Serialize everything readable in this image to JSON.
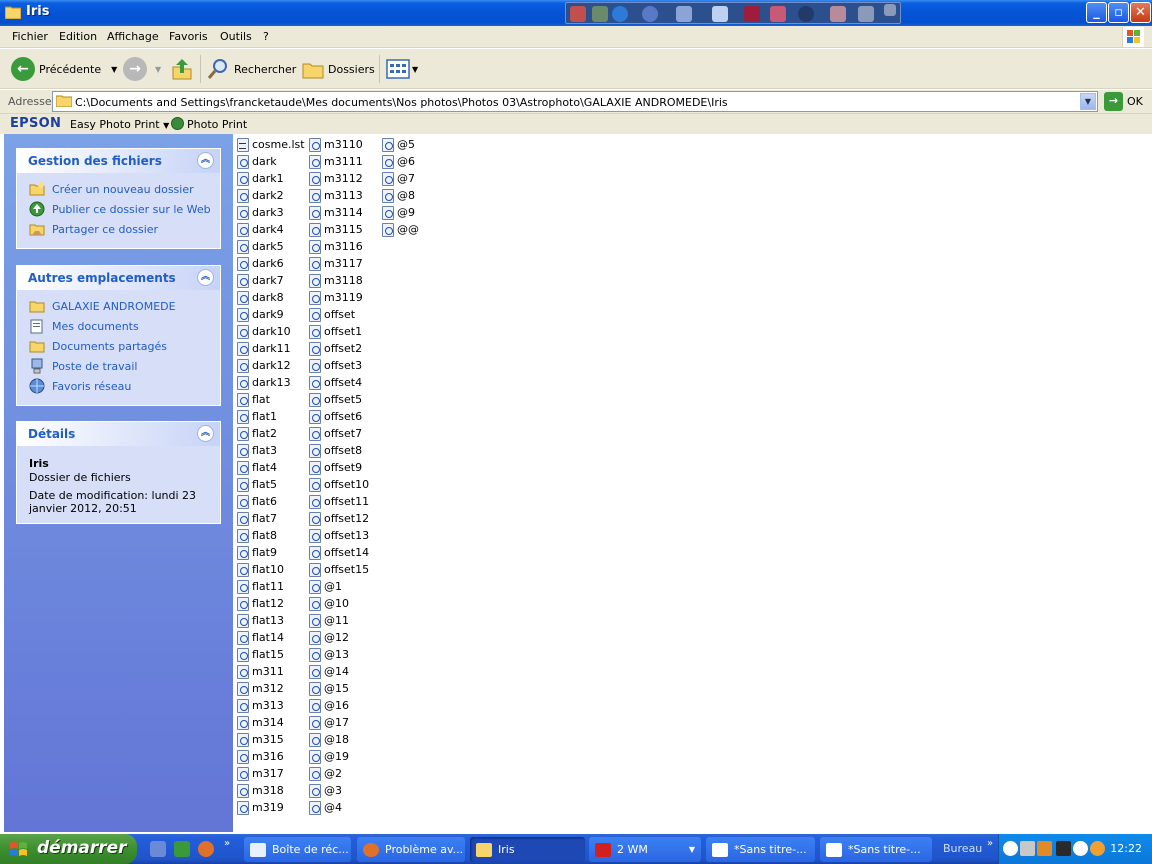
{
  "window": {
    "title": "Iris"
  },
  "menu": [
    "Fichier",
    "Edition",
    "Affichage",
    "Favoris",
    "Outils",
    "?"
  ],
  "toolbar": {
    "back_label": "Précédente",
    "search_label": "Rechercher",
    "folders_label": "Dossiers"
  },
  "address": {
    "label": "Adresse",
    "path": "C:\\Documents and Settings\\francketaude\\Mes documents\\Nos photos\\Photos 03\\Astrophoto\\GALAXIE ANDROMEDE\\Iris",
    "go_label": "OK"
  },
  "epson": {
    "brand": "EPSON",
    "easy_photo_print": "Easy Photo Print",
    "photo_print": "Photo Print"
  },
  "sidebar": {
    "file_tasks": {
      "title": "Gestion des fichiers",
      "items": [
        {
          "label": "Créer un nouveau dossier",
          "icon": "new-folder-icon"
        },
        {
          "label": "Publier ce dossier sur le Web",
          "icon": "web-publish-icon"
        },
        {
          "label": "Partager ce dossier",
          "icon": "share-folder-icon"
        }
      ]
    },
    "other_places": {
      "title": "Autres emplacements",
      "items": [
        {
          "label": "GALAXIE ANDROMEDE",
          "icon": "folder-icon"
        },
        {
          "label": "Mes documents",
          "icon": "my-documents-icon"
        },
        {
          "label": "Documents partagés",
          "icon": "shared-folder-icon"
        },
        {
          "label": "Poste de travail",
          "icon": "my-computer-icon"
        },
        {
          "label": "Favoris réseau",
          "icon": "network-icon"
        }
      ]
    },
    "details": {
      "title": "Détails",
      "name": "Iris",
      "type": "Dossier de fichiers",
      "modified_line1": "Date de modification: lundi 23",
      "modified_line2": "janvier 2012, 20:51"
    }
  },
  "files": {
    "column1": [
      "cosme.lst",
      "dark",
      "dark1",
      "dark2",
      "dark3",
      "dark4",
      "dark5",
      "dark6",
      "dark7",
      "dark8",
      "dark9",
      "dark10",
      "dark11",
      "dark12",
      "dark13",
      "flat",
      "flat1",
      "flat2",
      "flat3",
      "flat4",
      "flat5",
      "flat6",
      "flat7",
      "flat8",
      "flat9",
      "flat10",
      "flat11",
      "flat12",
      "flat13",
      "flat14",
      "flat15",
      "m311",
      "m312",
      "m313",
      "m314",
      "m315",
      "m316",
      "m317",
      "m318",
      "m319"
    ],
    "column2": [
      "m3110",
      "m3111",
      "m3112",
      "m3113",
      "m3114",
      "m3115",
      "m3116",
      "m3117",
      "m3118",
      "m3119",
      "offset",
      "offset1",
      "offset2",
      "offset3",
      "offset4",
      "offset5",
      "offset6",
      "offset7",
      "offset8",
      "offset9",
      "offset10",
      "offset11",
      "offset12",
      "offset13",
      "offset14",
      "offset15",
      "@1",
      "@10",
      "@11",
      "@12",
      "@13",
      "@14",
      "@15",
      "@16",
      "@17",
      "@18",
      "@19",
      "@2",
      "@3",
      "@4"
    ],
    "column3": [
      "@5",
      "@6",
      "@7",
      "@8",
      "@9",
      "@@"
    ]
  },
  "taskbar": {
    "start_label": "démarrer",
    "tasks": [
      {
        "label": "Boîte de réc...",
        "icon": "outlook-icon"
      },
      {
        "label": "Problème av...",
        "icon": "firefox-icon"
      },
      {
        "label": "Iris",
        "icon": "folder-icon",
        "active": true
      },
      {
        "label": "2 WM",
        "icon": "wm-icon"
      },
      {
        "label": "*Sans titre-...",
        "icon": "paint-icon"
      },
      {
        "label": "*Sans titre-...",
        "icon": "paint-icon"
      }
    ],
    "bureau_label": "Bureau",
    "clock": "12:22"
  },
  "colors": {
    "title_blue": "#0653d6",
    "sidebar_blue": "#7ba2e7",
    "link_blue": "#215dc6",
    "start_green": "#3c8f2e"
  }
}
